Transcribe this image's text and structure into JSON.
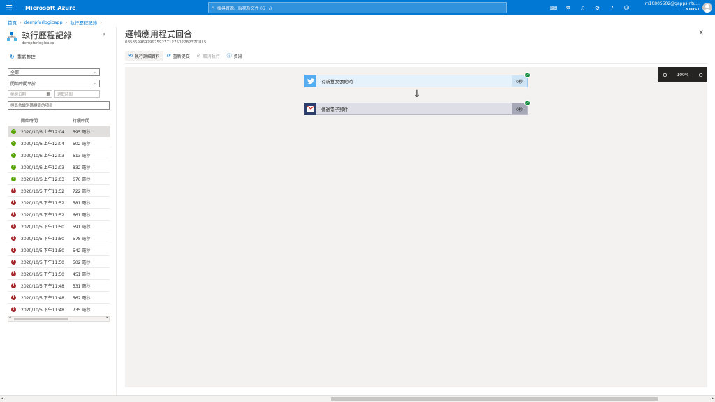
{
  "topbar": {
    "brand": "Microsoft Azure",
    "search_placeholder": "搜尋資源、服務及文件 (G+/)",
    "account_email": "m10805502@gapps.ntu...",
    "account_tenant": "NTUST",
    "icons": [
      "cloud-shell-icon",
      "directory-filter-icon",
      "notifications-icon",
      "settings-icon",
      "help-icon",
      "feedback-icon"
    ]
  },
  "breadcrumb": [
    "首頁",
    "dempforlogicapp",
    "執行歷程記錄"
  ],
  "left": {
    "title": "執行歷程記錄",
    "subtitle": "dempforlogicapp",
    "collapse": "«",
    "refresh_label": "重新整理",
    "filter_status": "全部",
    "filter_time": "開始時間早於",
    "date_placeholder": "挑選日期",
    "time_placeholder": "選取時間",
    "search_placeholder": "搜尋依識別碼標籤的項目",
    "col_start": "開始時間",
    "col_duration": "持續時間",
    "runs": [
      {
        "status": "ok",
        "time": "2020/10/6 上午12:04",
        "duration": "595 毫秒",
        "selected": true
      },
      {
        "status": "ok",
        "time": "2020/10/6 上午12:04",
        "duration": "502 毫秒"
      },
      {
        "status": "ok",
        "time": "2020/10/6 上午12:03",
        "duration": "613 毫秒"
      },
      {
        "status": "ok",
        "time": "2020/10/6 上午12:03",
        "duration": "832 毫秒"
      },
      {
        "status": "ok",
        "time": "2020/10/6 上午12:03",
        "duration": "676 毫秒"
      },
      {
        "status": "fail",
        "time": "2020/10/5 下午11:52",
        "duration": "722 毫秒"
      },
      {
        "status": "fail",
        "time": "2020/10/5 下午11:52",
        "duration": "581 毫秒"
      },
      {
        "status": "fail",
        "time": "2020/10/5 下午11:52",
        "duration": "661 毫秒"
      },
      {
        "status": "fail",
        "time": "2020/10/5 下午11:50",
        "duration": "591 毫秒"
      },
      {
        "status": "fail",
        "time": "2020/10/5 下午11:50",
        "duration": "578 毫秒"
      },
      {
        "status": "fail",
        "time": "2020/10/5 下午11:50",
        "duration": "542 毫秒"
      },
      {
        "status": "fail",
        "time": "2020/10/5 下午11:50",
        "duration": "502 毫秒"
      },
      {
        "status": "fail",
        "time": "2020/10/5 下午11:50",
        "duration": "451 毫秒"
      },
      {
        "status": "fail",
        "time": "2020/10/5 下午11:48",
        "duration": "531 毫秒"
      },
      {
        "status": "fail",
        "time": "2020/10/5 下午11:48",
        "duration": "562 毫秒"
      },
      {
        "status": "fail",
        "time": "2020/10/5 下午11:48",
        "duration": "735 毫秒"
      }
    ]
  },
  "main": {
    "title": "邏輯應用程式回合",
    "run_id": "08585996929975927712750228237CU15",
    "close": "✕",
    "toolbar": {
      "details": "執行詳細資料",
      "resubmit": "重新提交",
      "cancel": "取消執行",
      "info": "資訊"
    },
    "zoom_level": "100%",
    "steps": [
      {
        "label": "有新推文張貼時",
        "duration": "0秒"
      },
      {
        "label": "傳送電子郵件",
        "duration": "0秒"
      }
    ]
  }
}
